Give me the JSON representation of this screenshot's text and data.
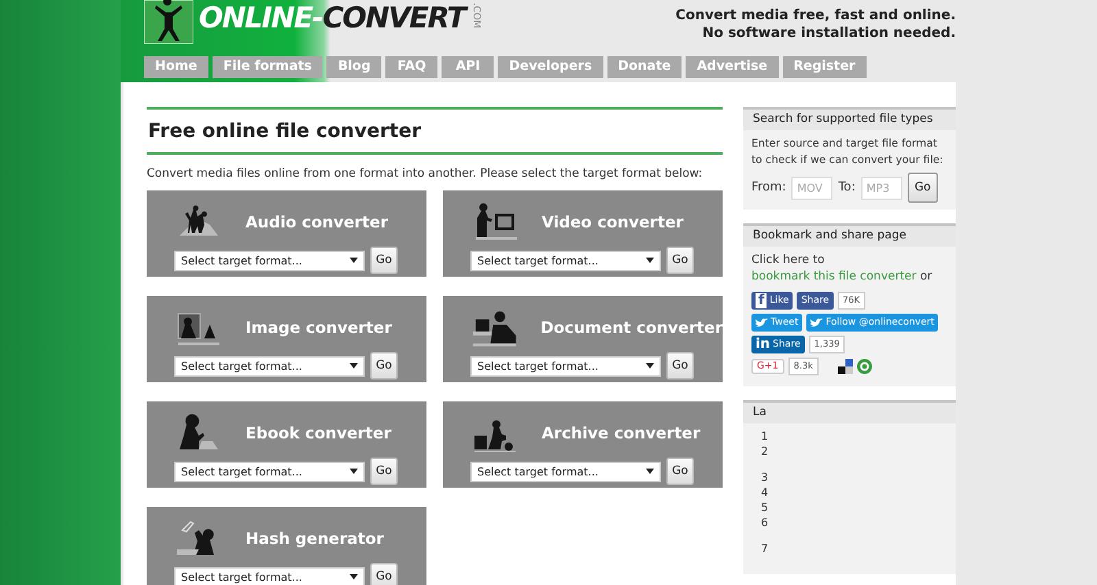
{
  "logo": {
    "part1": "ONLINE-",
    "part2": "CONVERT",
    "suffix": ".COM"
  },
  "tagline": [
    "Convert media free, fast and online.",
    "No software installation needed."
  ],
  "nav": [
    {
      "label": "Home"
    },
    {
      "label": "File formats"
    },
    {
      "label": "Blog"
    },
    {
      "label": "FAQ"
    },
    {
      "label": "API"
    },
    {
      "label": "Developers"
    },
    {
      "label": "Donate"
    },
    {
      "label": "Advertise"
    },
    {
      "label": "Register"
    }
  ],
  "main": {
    "title": "Free online file converter",
    "description": "Convert media files online from one format into another. Please select the target format below:",
    "converters": [
      {
        "kind": "audio",
        "title": "Audio converter",
        "select": "Select target format...",
        "button": "Go"
      },
      {
        "kind": "video",
        "title": "Video converter",
        "select": "Select target format...",
        "button": "Go"
      },
      {
        "kind": "image",
        "title": "Image converter",
        "select": "Select target format...",
        "button": "Go"
      },
      {
        "kind": "document",
        "title": "Document converter",
        "select": "Select target format...",
        "button": "Go"
      },
      {
        "kind": "ebook",
        "title": "Ebook converter",
        "select": "Select target format...",
        "button": "Go"
      },
      {
        "kind": "archive",
        "title": "Archive converter",
        "select": "Select target format...",
        "button": "Go"
      },
      {
        "kind": "hash",
        "title": "Hash generator",
        "select": "Select target format...",
        "button": "Go"
      }
    ]
  },
  "sidebar": {
    "search": {
      "title": "Search for supported file types",
      "text": "Enter source and target file format to check if we can convert your file:",
      "from_label": "From:",
      "from_placeholder": "MOV",
      "to_label": "To:",
      "to_placeholder": "MP3",
      "button": "Go"
    },
    "share": {
      "title": "Bookmark and share page",
      "text_before": "Click here to",
      "link": "bookmark this file converter",
      "text_after": "or",
      "rows": [
        [
          {
            "kind": "facebook",
            "icon": "f",
            "label": "Like"
          },
          {
            "kind": "facebook",
            "label": "Share",
            "count": "76K"
          }
        ],
        [
          {
            "kind": "twitter",
            "label": "Tweet"
          },
          {
            "kind": "twitter",
            "label": "Follow @onlineconvert"
          }
        ],
        [
          {
            "kind": "linkedin",
            "icon": "in",
            "label": "Share",
            "count": "1,339"
          }
        ],
        [
          {
            "kind": "gplus",
            "label": "G+1",
            "count": "8.3k"
          },
          {
            "kind": "delicious"
          },
          {
            "kind": "stumbleupon"
          }
        ]
      ]
    },
    "latest": {
      "title": "La",
      "groups": [
        [
          "1",
          "2"
        ],
        [
          "3",
          "4",
          "5",
          "6"
        ],
        [
          "7"
        ]
      ]
    }
  }
}
